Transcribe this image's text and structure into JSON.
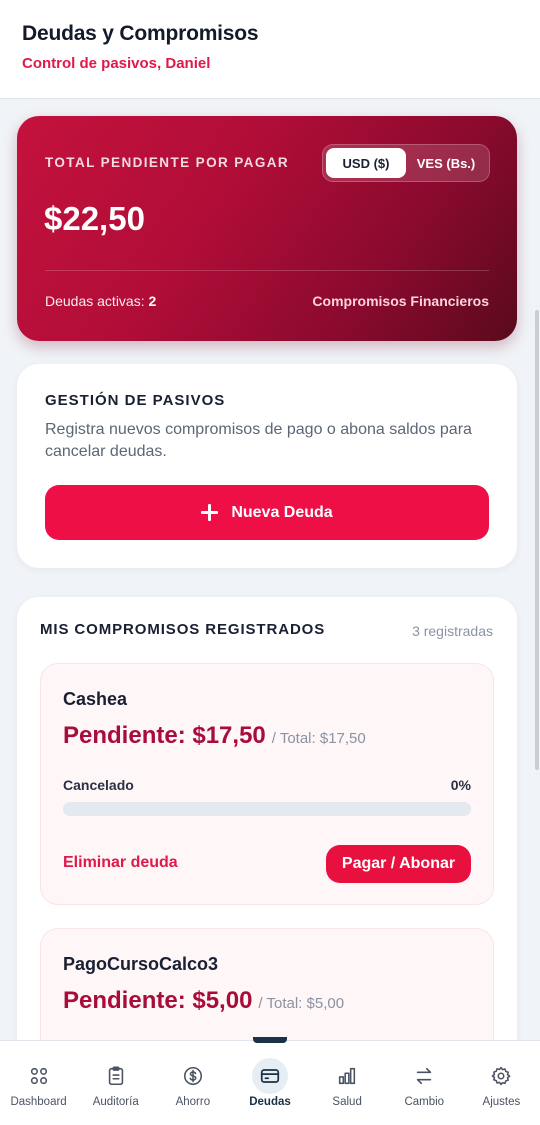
{
  "header": {
    "title": "Deudas y Compromisos",
    "subtitle": "Control de pasivos, Daniel"
  },
  "summary": {
    "label": "TOTAL PENDIENTE POR PAGAR",
    "currency_options": [
      "USD ($)",
      "VES (Bs.)"
    ],
    "selected_currency": "USD ($)",
    "amount": "$22,50",
    "active_label": "Deudas activas:",
    "active_count": "2",
    "tag": "Compromisos Financieros"
  },
  "gestion": {
    "title": "GESTIÓN DE PASIVOS",
    "description": "Registra nuevos compromisos de pago o abona saldos para cancelar deudas.",
    "new_debt_label": "Nueva Deuda"
  },
  "commitments": {
    "title": "MIS COMPROMISOS REGISTRADOS",
    "count_label": "3 registradas",
    "items": [
      {
        "name": "Cashea",
        "pending": "Pendiente: $17,50",
        "total": "/ Total: $17,50",
        "progress_label": "Cancelado",
        "progress_pct": "0%",
        "progress_value": 0,
        "delete_label": "Eliminar deuda",
        "pay_label": "Pagar / Abonar"
      },
      {
        "name": "PagoCursoCalco3",
        "pending": "Pendiente: $5,00",
        "total": "/ Total: $5,00"
      }
    ]
  },
  "nav": {
    "items": [
      {
        "label": "Dashboard",
        "icon": "grid-icon"
      },
      {
        "label": "Auditoría",
        "icon": "clipboard-icon"
      },
      {
        "label": "Ahorro",
        "icon": "dollar-circle-icon"
      },
      {
        "label": "Deudas",
        "icon": "card-icon",
        "active": true
      },
      {
        "label": "Salud",
        "icon": "bar-chart-icon"
      },
      {
        "label": "Cambio",
        "icon": "swap-arrows-icon"
      },
      {
        "label": "Ajustes",
        "icon": "gear-icon"
      }
    ]
  },
  "colors": {
    "accent": "#ed0f45",
    "hero_start": "#c4123d",
    "hero_end": "#5a0a1c",
    "pending_text": "#a80c3a",
    "nav_active": "#1a3146"
  }
}
